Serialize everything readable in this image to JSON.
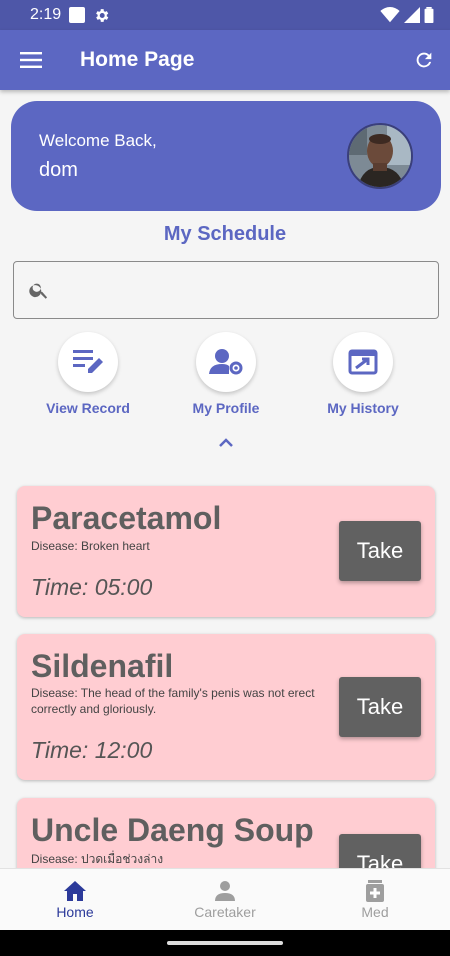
{
  "status_bar": {
    "time": "2:19"
  },
  "app_bar": {
    "title": "Home Page"
  },
  "welcome": {
    "greeting": "Welcome Back,",
    "name": "dom"
  },
  "schedule": {
    "title": "My Schedule"
  },
  "search": {
    "placeholder": "",
    "value": ""
  },
  "quick_actions": [
    {
      "label": "View Record",
      "icon": "edit-note-icon"
    },
    {
      "label": "My Profile",
      "icon": "manage-accounts-icon"
    },
    {
      "label": "My History",
      "icon": "history-ticket-icon"
    }
  ],
  "medications": [
    {
      "name": "Paracetamol",
      "disease": "Disease: Broken heart",
      "time": "Time: 05:00",
      "action": "Take"
    },
    {
      "name": "Sildenafil",
      "disease": "Disease: The head of the family's penis was not erect correctly and gloriously.",
      "time": "Time: 12:00",
      "action": "Take"
    },
    {
      "name": "Uncle Daeng Soup",
      "disease": "Disease: ปวดเมื่อช่วงล่าง",
      "time": "",
      "action": "Take"
    }
  ],
  "bottom_nav": [
    {
      "label": "Home",
      "icon": "home-icon",
      "active": true
    },
    {
      "label": "Caretaker",
      "icon": "person-icon",
      "active": false
    },
    {
      "label": "Med",
      "icon": "medical-icon",
      "active": false
    }
  ],
  "colors": {
    "primary": "#5c67c2",
    "status_bar": "#4e57a8",
    "card": "#ffcdd2",
    "take_button": "#616161",
    "nav_active": "#2c3a9a",
    "nav_inactive": "#9e9e9e"
  }
}
